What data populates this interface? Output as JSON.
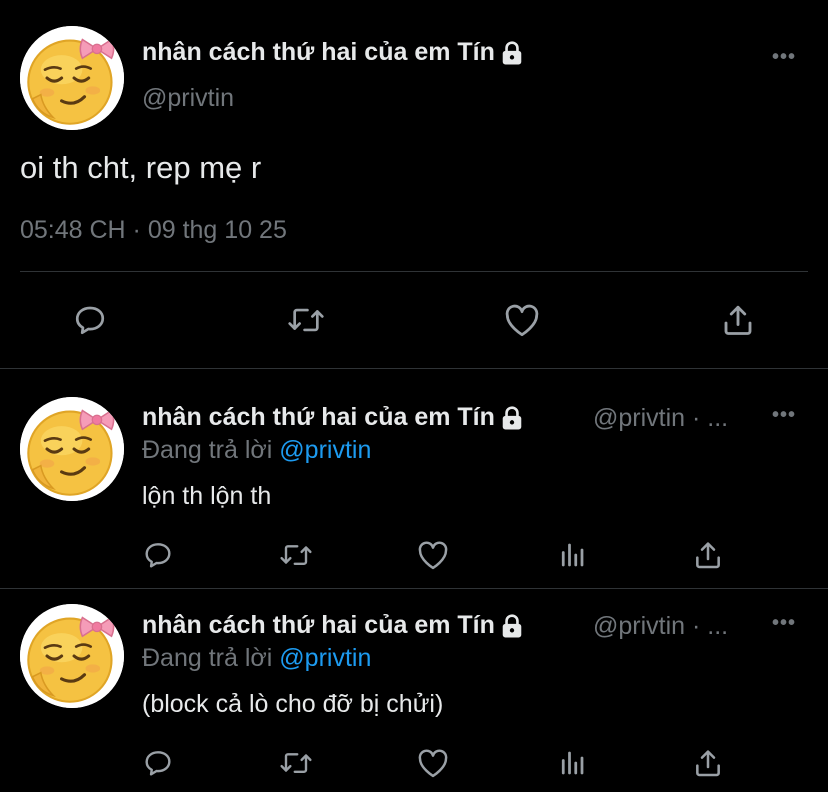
{
  "main_tweet": {
    "display_name": "nhân cách thứ hai của em Tín",
    "handle": "@privtin",
    "text": "oi th cht, rep mẹ r",
    "timestamp": "05:48 CH · 09 thg 10 25",
    "more_label": "•••",
    "icons": [
      "reply-icon",
      "retweet-icon",
      "like-icon",
      "share-icon"
    ]
  },
  "replies": [
    {
      "display_name": "nhân cách thứ hai của em Tín",
      "handle_time": "@privtin · ...",
      "replying_prefix": "Đang trả lời",
      "replying_mention": "@privtin",
      "text": "lộn th lộn th",
      "more_label": "•••"
    },
    {
      "display_name": "nhân cách thứ hai của em Tín",
      "handle_time": "@privtin · ...",
      "replying_prefix": "Đang trả lời",
      "replying_mention": "@privtin",
      "text": "(block cả lò cho đỡ bị chửi)",
      "more_label": "•••"
    }
  ],
  "colors": {
    "background": "#000000",
    "text": "#e7e9ea",
    "secondary": "#71767b",
    "mention": "#1d9bf0",
    "divider": "#2f3336"
  }
}
